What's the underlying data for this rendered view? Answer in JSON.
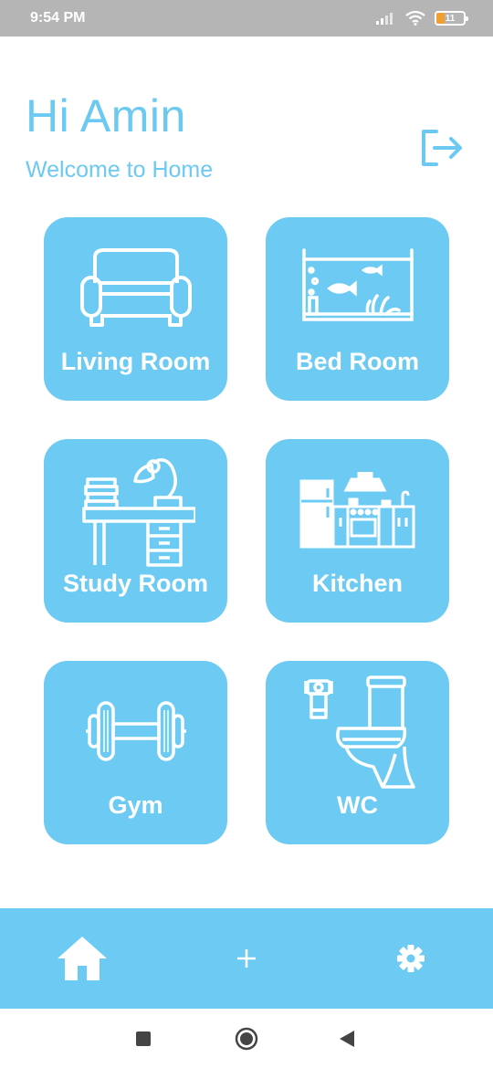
{
  "status_bar": {
    "time": "9:54 PM",
    "battery": "11",
    "icons": [
      "signal-icon",
      "wifi-icon",
      "battery-icon"
    ]
  },
  "header": {
    "greeting": "Hi Amin",
    "subtitle": "Welcome to Home",
    "logout_icon": "logout-icon"
  },
  "rooms": [
    {
      "label": "Living Room",
      "icon": "sofa-icon"
    },
    {
      "label": "Bed Room",
      "icon": "aquarium-icon"
    },
    {
      "label": "Study Room",
      "icon": "desk-lamp-icon"
    },
    {
      "label": "Kitchen",
      "icon": "kitchen-icon"
    },
    {
      "label": "Gym",
      "icon": "dumbbell-icon"
    },
    {
      "label": "WC",
      "icon": "toilet-icon"
    }
  ],
  "bottom_nav": {
    "items": [
      "home-icon",
      "plus-icon",
      "gear-icon"
    ],
    "active": "home-icon"
  },
  "system_nav": {
    "items": [
      "recent-apps-icon",
      "home-circle-icon",
      "back-icon"
    ]
  },
  "colors": {
    "accent": "#6dcbf3",
    "text_accent": "#6cc9f1",
    "status_bar": "#b5b5b5",
    "background": "#ffffff"
  }
}
